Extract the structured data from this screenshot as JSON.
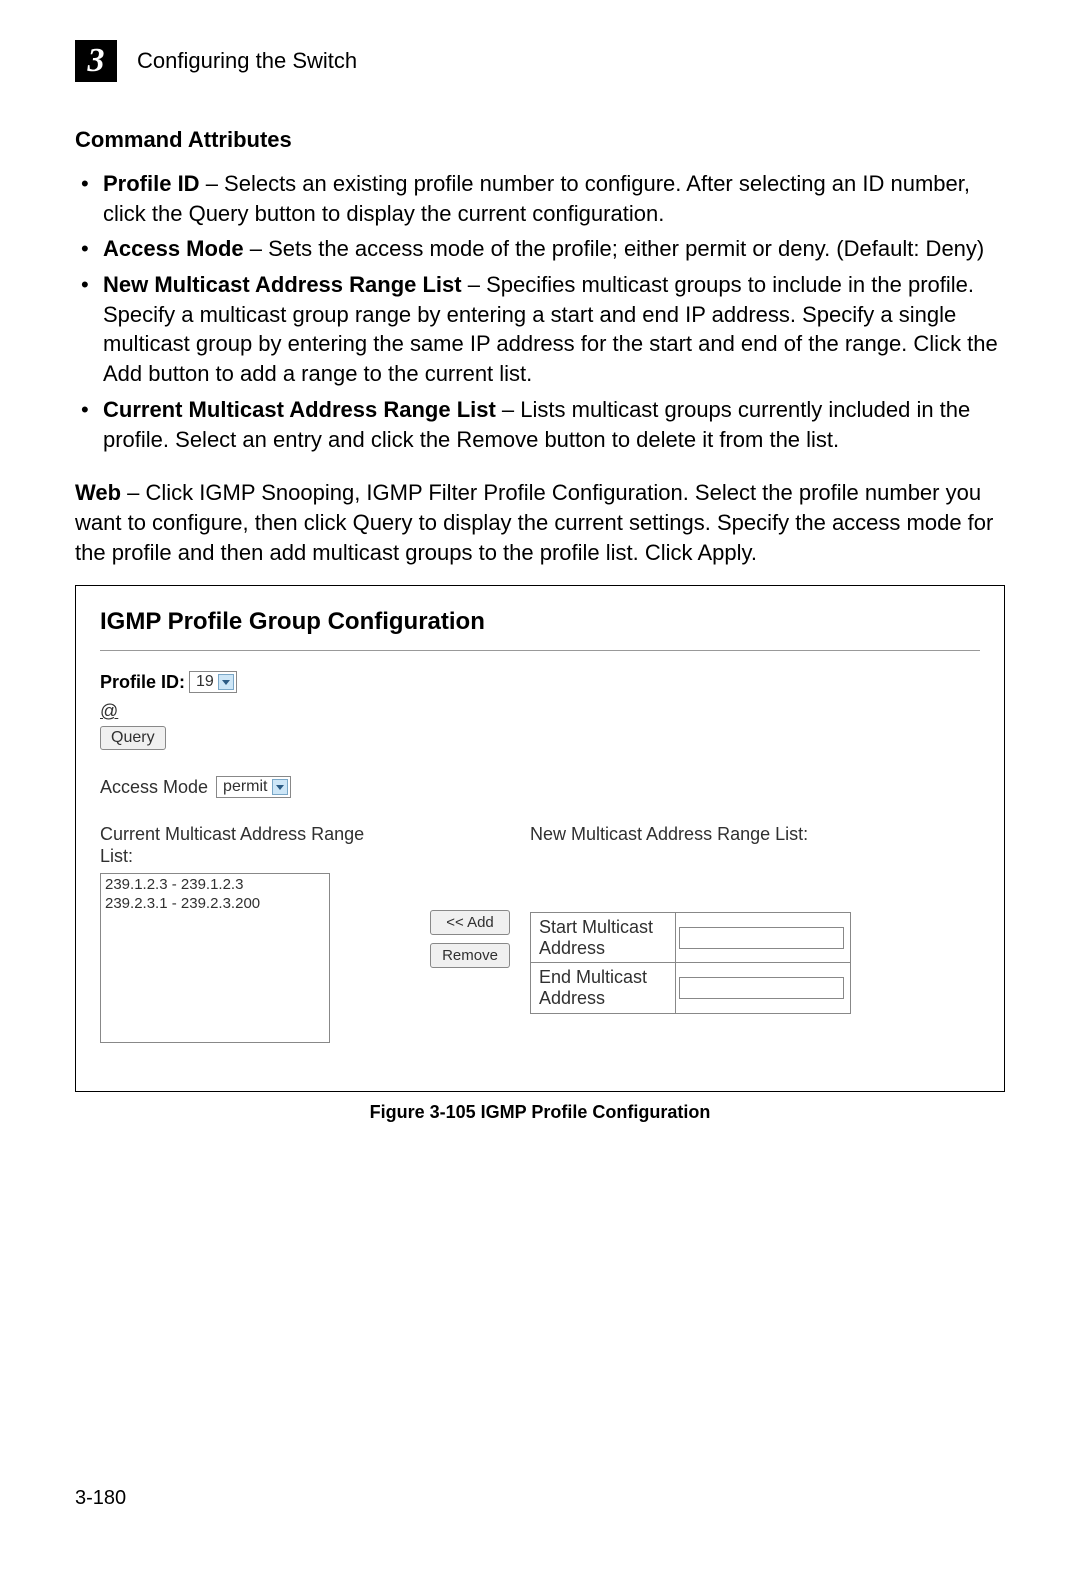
{
  "header": {
    "chapter_number": "3",
    "chapter_title": "Configuring the Switch"
  },
  "section": {
    "heading": "Command Attributes",
    "items": [
      {
        "label": "Profile ID",
        "desc": " – Selects an existing profile number to configure. After selecting an ID number, click the Query button to display the current configuration."
      },
      {
        "label": "Access Mode",
        "desc": " – Sets the access mode of the profile; either permit or deny. (Default: Deny)"
      },
      {
        "label": "New Multicast Address Range List",
        "desc": " – Specifies multicast groups to include in the profile. Specify a multicast group range by entering a start and end IP address. Specify a single multicast group by entering the same IP address for the start and end of the range. Click the Add button to add a range to the current list."
      },
      {
        "label": "Current Multicast Address Range List",
        "desc": " – Lists multicast groups currently included in the profile. Select an entry and click the Remove button to delete it from the list."
      }
    ]
  },
  "web_paragraph": {
    "label": "Web",
    "desc": " – Click IGMP Snooping, IGMP Filter Profile Configuration. Select the profile number you want to configure, then click Query to display the current settings. Specify the access mode for the profile and then add multicast groups to the profile list. Click Apply."
  },
  "screenshot": {
    "title": "IGMP Profile Group Configuration",
    "profile_id_label": "Profile ID:",
    "profile_id_value": "19",
    "at_symbol": "@",
    "query_button": "Query",
    "access_mode_label": "Access Mode",
    "access_mode_value": "permit",
    "current_list_label": "Current Multicast Address Range List:",
    "current_list_items": [
      "239.1.2.3 - 239.1.2.3",
      "239.2.3.1 - 239.2.3.200"
    ],
    "add_button": "<< Add",
    "remove_button": "Remove",
    "new_list_label": "New Multicast Address Range List:",
    "start_label": "Start Multicast Address",
    "end_label": "End Multicast Address"
  },
  "figure_caption": "Figure 3-105  IGMP Profile Configuration",
  "page_number": "3-180"
}
